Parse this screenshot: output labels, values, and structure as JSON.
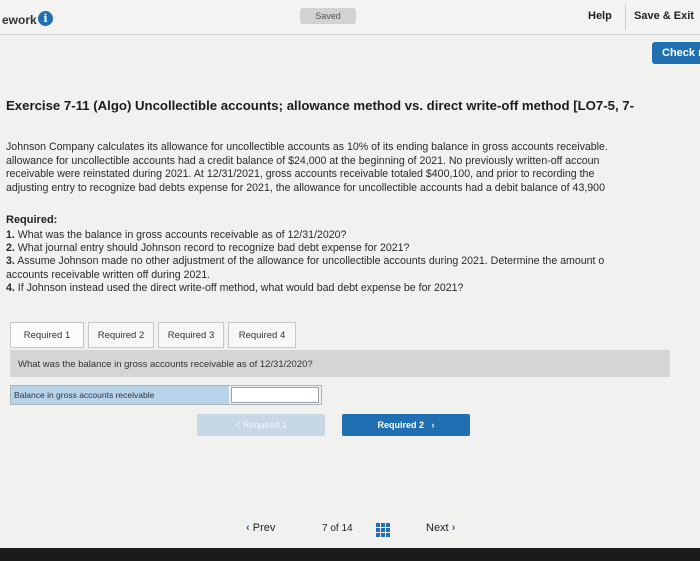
{
  "header": {
    "brand": "ework",
    "info_icon": "i",
    "saved": "Saved",
    "help": "Help",
    "save_exit": "Save & Exit",
    "check": "Check m"
  },
  "exercise": {
    "title": "Exercise 7-11 (Algo) Uncollectible accounts; allowance method vs. direct write-off method [LO7-5, 7-",
    "paragraph": [
      "Johnson Company calculates its allowance for uncollectible accounts as 10% of its ending balance in gross accounts receivable.",
      "allowance for uncollectible accounts had a credit balance of $24,000 at the beginning of 2021. No previously written-off accoun",
      "receivable were reinstated during 2021. At 12/31/2021, gross accounts receivable totaled $400,100, and prior to recording the",
      "adjusting entry to recognize bad debts expense for 2021, the allowance for uncollectible accounts had a debit balance of 43,900"
    ],
    "required_heading": "Required:",
    "requirements": [
      {
        "num": "1.",
        "text": " What was the balance in gross accounts receivable as of 12/31/2020?"
      },
      {
        "num": "2.",
        "text": " What journal entry should Johnson record to recognize bad debt expense for 2021?"
      },
      {
        "num": "3.",
        "text": " Assume Johnson made no other adjustment of the allowance for uncollectible accounts during 2021. Determine the amount o"
      },
      {
        "num": "",
        "text": "accounts receivable written off during 2021."
      },
      {
        "num": "4.",
        "text": " If Johnson instead used the direct write-off method, what would bad debt expense be for 2021?"
      }
    ]
  },
  "tabs": [
    {
      "label": "Required 1",
      "active": true
    },
    {
      "label": "Required 2",
      "active": false
    },
    {
      "label": "Required 3",
      "active": false
    },
    {
      "label": "Required 4",
      "active": false
    }
  ],
  "question": "What was the balance in gross accounts receivable as of 12/31/2020?",
  "answer": {
    "label": "Balance in gross accounts receivable",
    "value": ""
  },
  "nav_buttons": {
    "prev_required": "< Required 1",
    "next_required": "Required 2"
  },
  "pager": {
    "prev": "Prev",
    "current": "7",
    "of": "of",
    "total": "14",
    "next": "Next"
  },
  "colors": {
    "accent": "#1f6fb2",
    "answer_label_bg": "#b7d4ea",
    "question_bar_bg": "#d3d6d4"
  },
  "icons": [
    "info-icon",
    "chevron-left-icon",
    "chevron-right-icon",
    "grid-icon"
  ]
}
